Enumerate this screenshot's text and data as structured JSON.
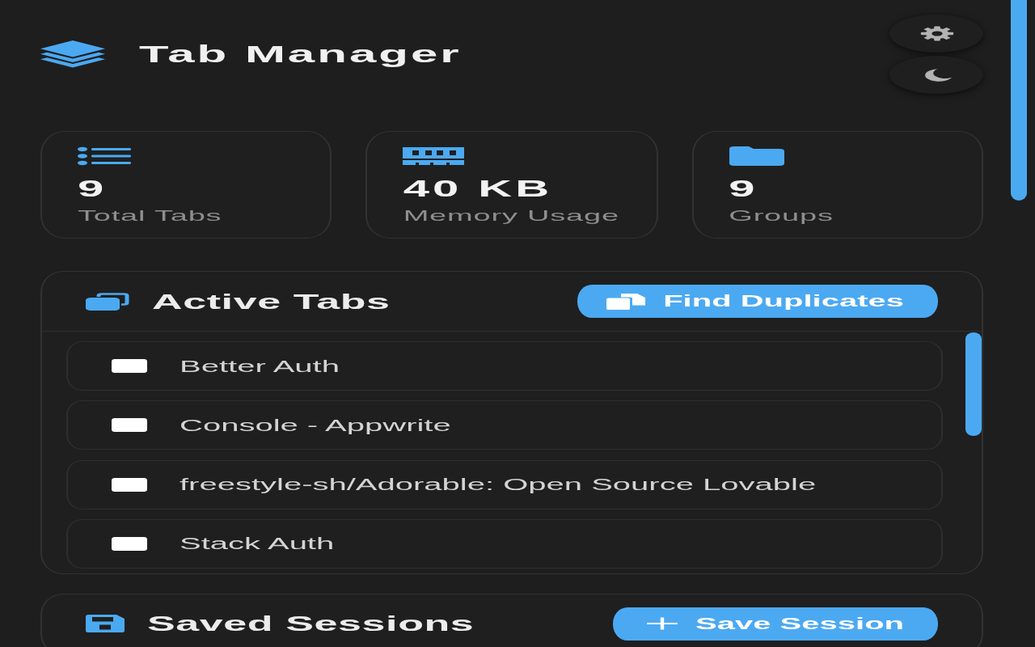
{
  "header": {
    "title": "Tab Manager"
  },
  "stats": [
    {
      "kind": "tabs",
      "value": "9",
      "label": "Total Tabs"
    },
    {
      "kind": "memory",
      "value": "40 KB",
      "label": "Memory Usage"
    },
    {
      "kind": "groups",
      "value": "9",
      "label": "Groups"
    }
  ],
  "active_tabs": {
    "title": "Active Tabs",
    "action": "Find Duplicates",
    "tabs": [
      {
        "title": "Better Auth",
        "checked": false
      },
      {
        "title": "Console - Appwrite",
        "checked": false
      },
      {
        "title": "freestyle-sh/Adorable: Open Source Lovable",
        "checked": false
      },
      {
        "title": "Stack Auth",
        "checked": false
      }
    ]
  },
  "saved_sessions": {
    "title": "Saved Sessions",
    "action": "Save Session"
  }
}
